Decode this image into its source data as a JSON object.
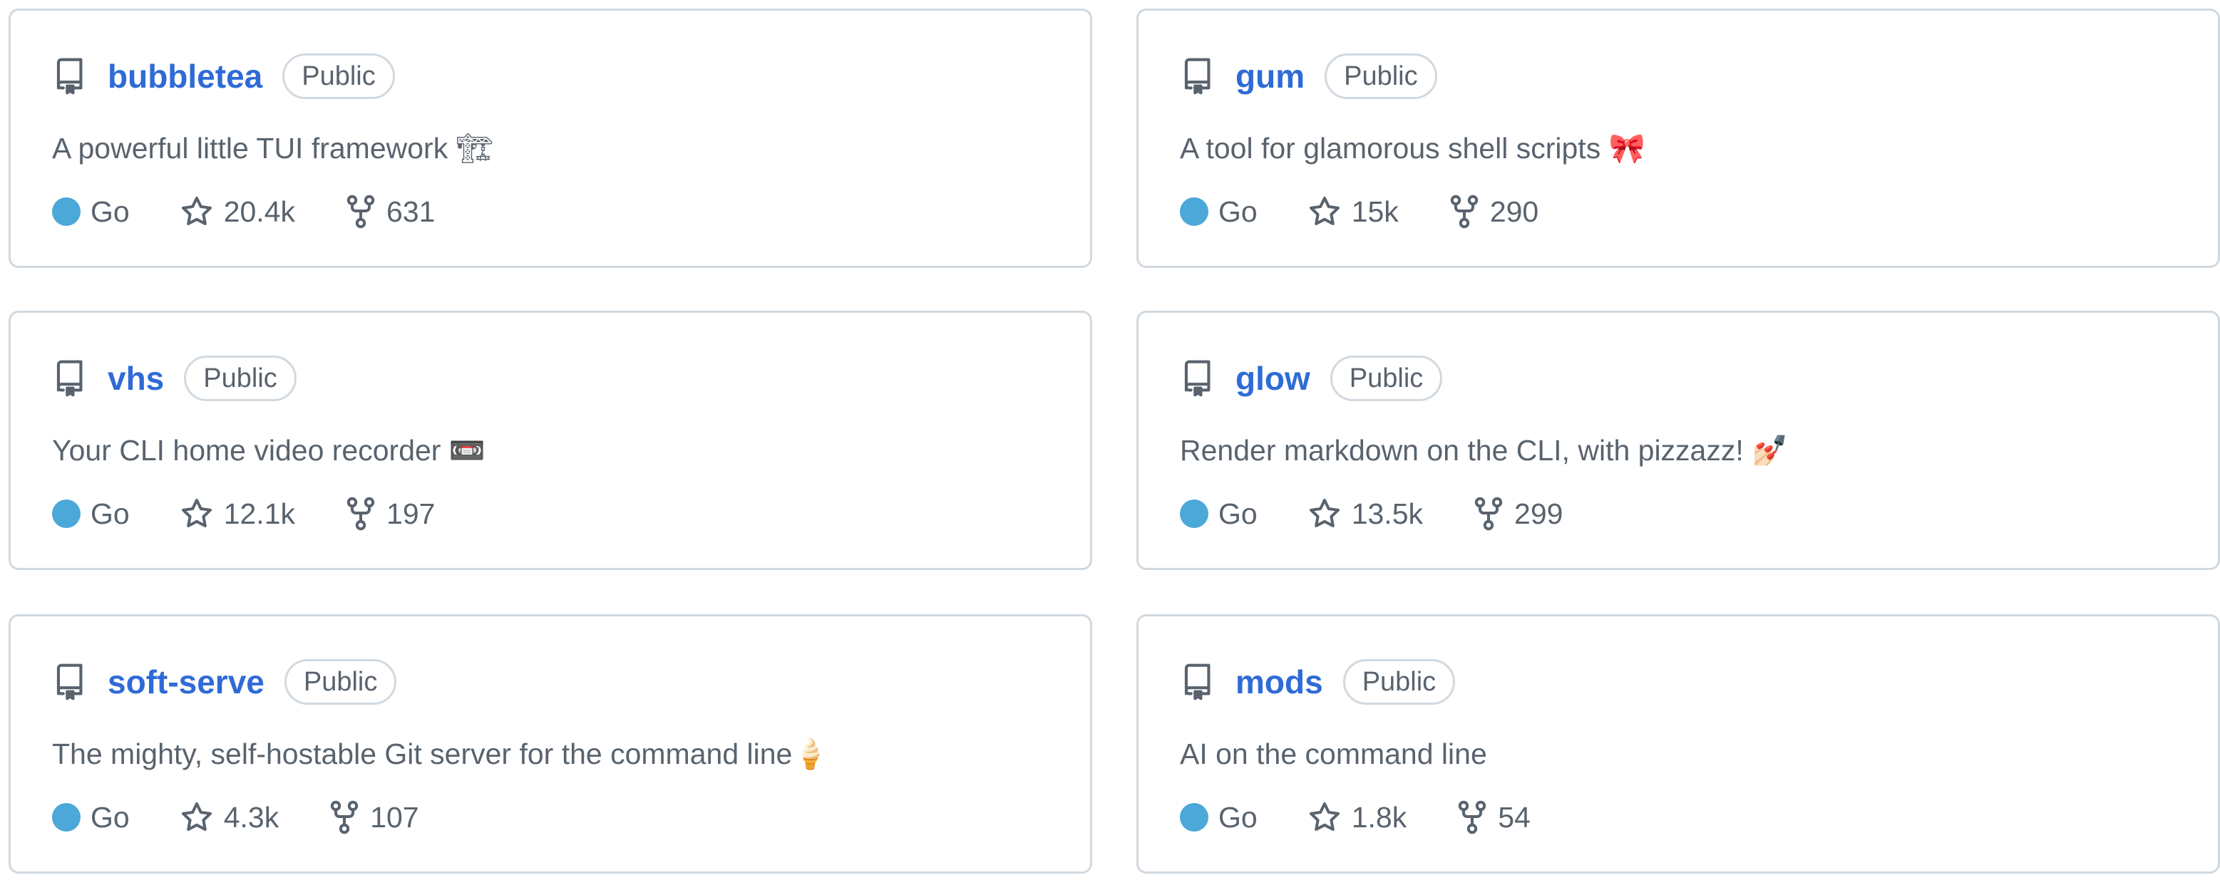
{
  "repos": [
    {
      "name": "bubbletea",
      "visibility": "Public",
      "description": "A powerful little TUI framework 🏗",
      "language": "Go",
      "language_color": "#4ba8d8",
      "stars": "20.4k",
      "forks": "631"
    },
    {
      "name": "gum",
      "visibility": "Public",
      "description": "A tool for glamorous shell scripts 🎀",
      "language": "Go",
      "language_color": "#4ba8d8",
      "stars": "15k",
      "forks": "290"
    },
    {
      "name": "vhs",
      "visibility": "Public",
      "description": "Your CLI home video recorder 📼",
      "language": "Go",
      "language_color": "#4ba8d8",
      "stars": "12.1k",
      "forks": "197"
    },
    {
      "name": "glow",
      "visibility": "Public",
      "description": "Render markdown on the CLI, with pizzazz! 💅🏻",
      "language": "Go",
      "language_color": "#4ba8d8",
      "stars": "13.5k",
      "forks": "299"
    },
    {
      "name": "soft-serve",
      "visibility": "Public",
      "description": "The mighty, self-hostable Git server for the command line🍦",
      "language": "Go",
      "language_color": "#4ba8d8",
      "stars": "4.3k",
      "forks": "107"
    },
    {
      "name": "mods",
      "visibility": "Public",
      "description": "AI on the command line",
      "language": "Go",
      "language_color": "#4ba8d8",
      "stars": "1.8k",
      "forks": "54"
    }
  ],
  "icons": {
    "repo": "repo-icon",
    "star": "star-icon",
    "fork": "fork-icon",
    "language_dot": "language-color-dot"
  },
  "colors": {
    "link": "#2f6bd6",
    "muted_text": "#59636e",
    "border": "#d1d9e0"
  }
}
